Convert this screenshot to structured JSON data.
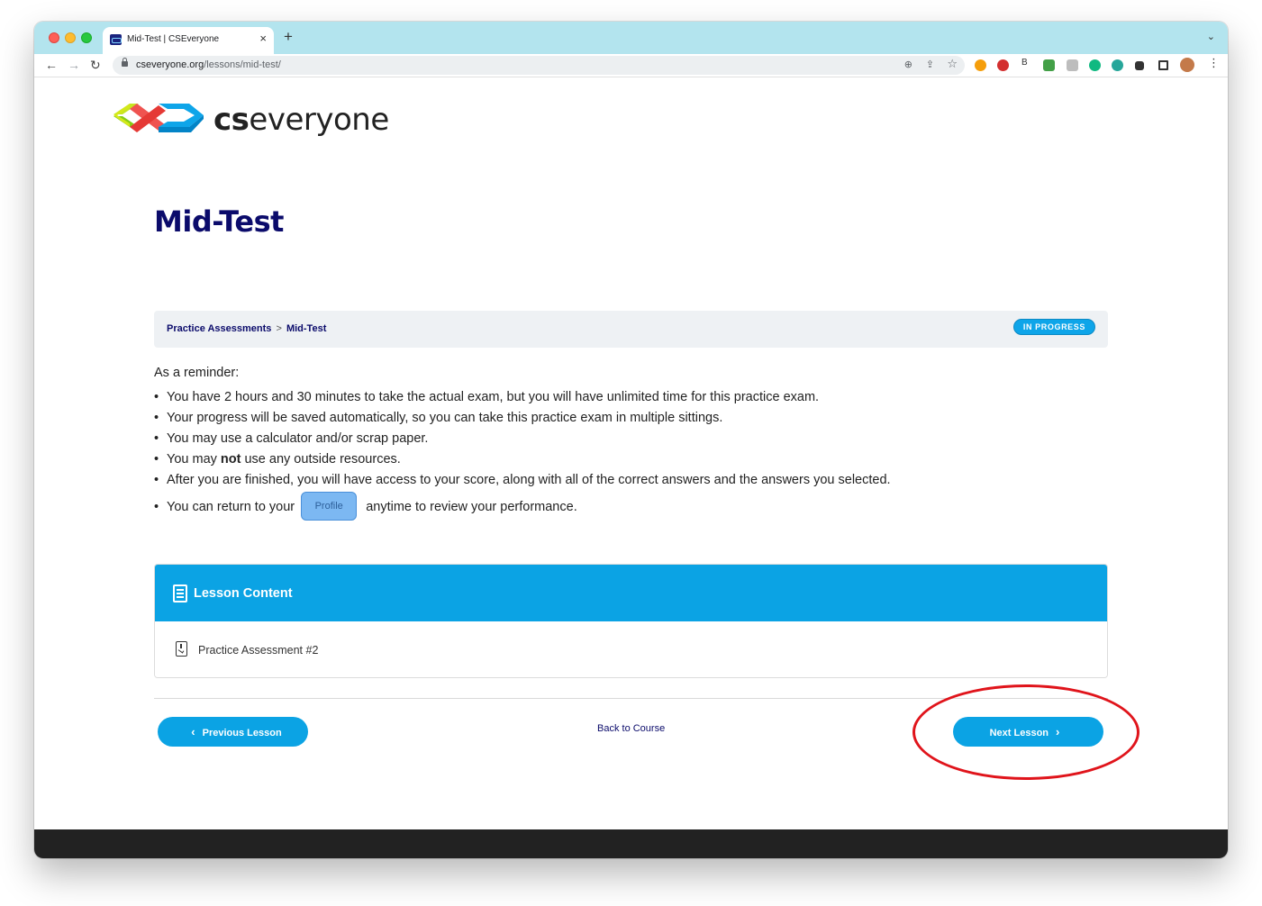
{
  "browser": {
    "tab_title": "Mid-Test | CSEveryone",
    "tab_close": "×",
    "new_tab": "+",
    "tab_menu": "⌄",
    "back": "←",
    "forward": "→",
    "reload": "↻",
    "url_domain": "cseveryone.org",
    "url_path": "/lessons/mid-test/",
    "zoom_icon": "⊕",
    "share_icon": "⇪",
    "star_icon": "☆",
    "ext_abp": "ABP",
    "ext_b": "B",
    "menu": "⋮"
  },
  "logo": {
    "brand_bold": "cs",
    "brand_rest": "everyone"
  },
  "page": {
    "title": "Mid-Test",
    "breadcrumb_parent": "Practice Assessments",
    "breadcrumb_sep": ">",
    "breadcrumb_current": "Mid-Test",
    "status": "IN PROGRESS"
  },
  "reminder": {
    "intro": "As a reminder:",
    "b1": "You have 2 hours and 30 minutes to take the actual exam, but you will have unlimited time for this practice exam.",
    "b2": "Your progress will be saved automatically, so you can take this practice exam in multiple sittings.",
    "b3": "You may use a calculator and/or scrap paper.",
    "b4_pre": "You may ",
    "b4_bold": "not",
    "b4_post": " use any outside resources.",
    "b5": "After you are finished, you will have access to your score, along with all of the correct answers and the answers you selected.",
    "b6_pre": "You can return to your",
    "b6_button": "Profile",
    "b6_post": "anytime to review your performance."
  },
  "lesson_content": {
    "heading": "Lesson Content",
    "items": [
      {
        "label": "Practice Assessment #2"
      }
    ]
  },
  "navigation": {
    "prev_chev": "‹",
    "prev_label": "Previous Lesson",
    "back_label": "Back to Course",
    "next_label": "Next Lesson",
    "next_chev": "›"
  },
  "colors": {
    "accent": "#0ba3e4",
    "title": "#0b0b6b",
    "annotation": "#e0141b",
    "tabbar": "#b3e4ee"
  }
}
